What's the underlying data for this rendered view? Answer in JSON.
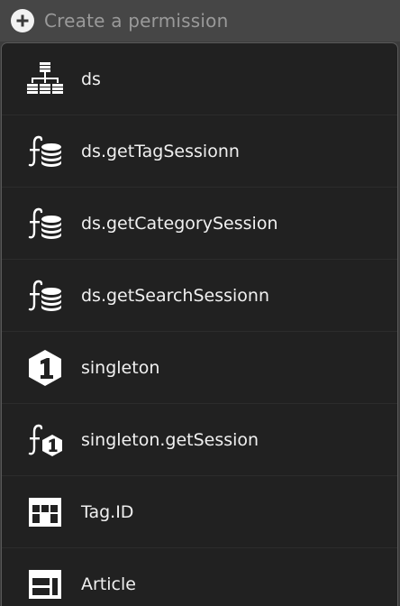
{
  "header": {
    "label": "Create a permission",
    "icon": "plus-circle-icon"
  },
  "items": [
    {
      "label": "ds",
      "icon": "sitemap-icon"
    },
    {
      "label": "ds.getTagSessionn",
      "icon": "function-database-icon"
    },
    {
      "label": "ds.getCategorySession",
      "icon": "function-database-icon"
    },
    {
      "label": "ds.getSearchSessionn",
      "icon": "function-database-icon"
    },
    {
      "label": "singleton",
      "icon": "hexagon-one-icon"
    },
    {
      "label": "singleton.getSession",
      "icon": "function-hexagon-one-icon"
    },
    {
      "label": "Tag.ID",
      "icon": "table-icon"
    },
    {
      "label": "Article",
      "icon": "layout-panel-icon"
    }
  ],
  "colors": {
    "header_bg": "#464646",
    "panel_bg": "#212121",
    "text": "#f0f0f0",
    "placeholder": "#9a9a9a"
  }
}
